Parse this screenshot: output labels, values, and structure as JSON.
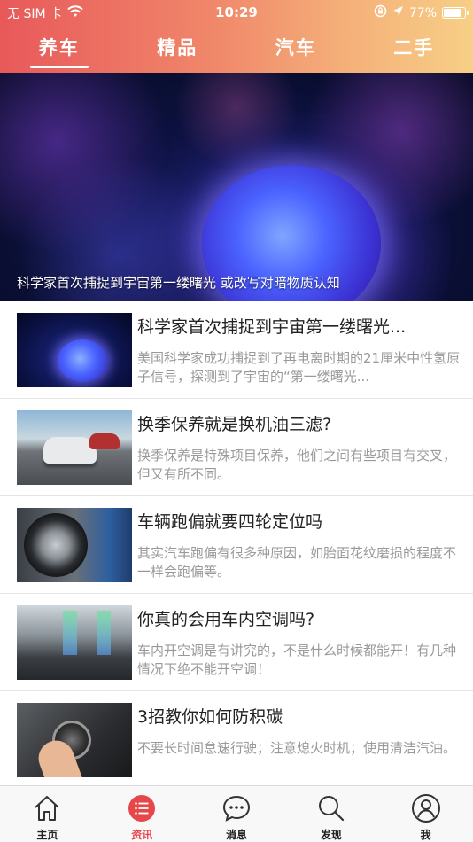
{
  "status_bar": {
    "carrier": "无 SIM 卡",
    "time": "10:29",
    "battery_percent": "77%",
    "battery_level": 0.77
  },
  "top_tabs": [
    {
      "label": "养车",
      "active": true
    },
    {
      "label": "精品",
      "active": false
    },
    {
      "label": "汽车",
      "active": false
    },
    {
      "label": "二手",
      "active": false
    }
  ],
  "banner": {
    "caption": "科学家首次捕捉到宇宙第一缕曙光 或改写对暗物质认知"
  },
  "news": [
    {
      "title": "科学家首次捕捉到宇宙第一缕曙光...",
      "desc": "美国科学家成功捕捉到了再电离时期的21厘米中性氢原子信号，探测到了宇宙的“第一缕曙光...",
      "thumb": "space"
    },
    {
      "title": "换季保养就是换机油三滤?",
      "desc": "换季保养是特殊项目保养，他们之间有些项目有交叉，但又有所不同。",
      "thumb": "road"
    },
    {
      "title": "车辆跑偏就要四轮定位吗",
      "desc": "其实汽车跑偏有很多种原因，如胎面花纹磨损的程度不一样会跑偏等。",
      "thumb": "wheel"
    },
    {
      "title": "你真的会用车内空调吗?",
      "desc": "车内开空调是有讲究的，不是什么时候都能开！有几种情况下绝不能开空调！",
      "thumb": "ac"
    },
    {
      "title": "3招教你如何防积碳",
      "desc": "不要长时间怠速行驶；注意熄火时机；使用清洁汽油。",
      "thumb": "button"
    }
  ],
  "bottom_nav": [
    {
      "label": "主页",
      "icon": "home-icon",
      "active": false
    },
    {
      "label": "资讯",
      "icon": "list-icon",
      "active": true
    },
    {
      "label": "消息",
      "icon": "chat-icon",
      "active": false
    },
    {
      "label": "发现",
      "icon": "search-icon",
      "active": false
    },
    {
      "label": "我",
      "icon": "user-icon",
      "active": false
    }
  ],
  "colors": {
    "accent": "#e6474a",
    "header_gradient_start": "#e8595a",
    "header_gradient_end": "#f7cf86"
  }
}
